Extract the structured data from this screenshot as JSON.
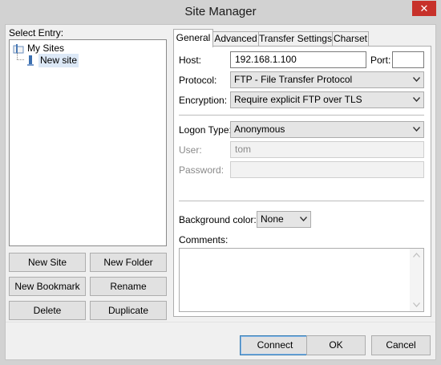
{
  "window": {
    "title": "Site Manager",
    "close_glyph": "✕"
  },
  "tree": {
    "label": "Select Entry:",
    "items": [
      {
        "label": "My Sites",
        "icon": "folder-icon"
      },
      {
        "label": "New site",
        "icon": "server-icon",
        "selected": true
      }
    ]
  },
  "left_buttons": {
    "new_site": "New Site",
    "new_folder": "New Folder",
    "new_bookmark": "New Bookmark",
    "rename": "Rename",
    "delete": "Delete",
    "duplicate": "Duplicate"
  },
  "tabs": [
    "General",
    "Advanced",
    "Transfer Settings",
    "Charset"
  ],
  "general": {
    "host_label": "Host:",
    "host_value": "192.168.1.100",
    "port_label": "Port:",
    "port_value": "",
    "protocol_label": "Protocol:",
    "protocol_value": "FTP - File Transfer Protocol",
    "encryption_label": "Encryption:",
    "encryption_value": "Require explicit FTP over TLS",
    "logon_label": "Logon Type:",
    "logon_value": "Anonymous",
    "user_label": "User:",
    "user_value": "tom",
    "password_label": "Password:",
    "password_value": "",
    "bg_label": "Background color:",
    "bg_value": "None",
    "comments_label": "Comments:",
    "comments_value": ""
  },
  "dialog_buttons": {
    "connect": "Connect",
    "ok": "OK",
    "cancel": "Cancel"
  },
  "colors": {
    "accent": "#3c7fb1",
    "close": "#c7312a",
    "selection": "#dce8f6"
  }
}
